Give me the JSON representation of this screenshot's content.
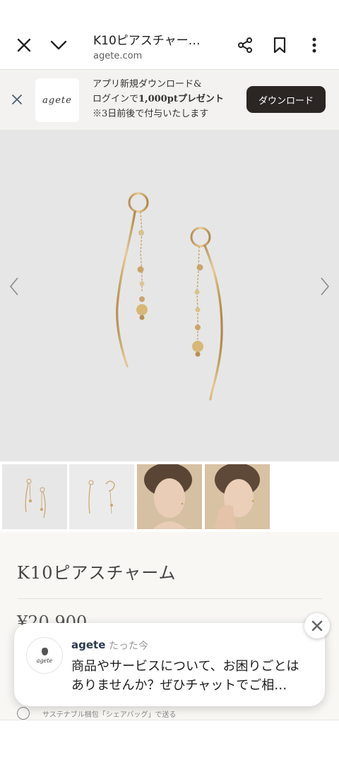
{
  "toolbar": {
    "title": "K10ピアスチャー…",
    "url": "agete.com",
    "icons": [
      "close-icon",
      "chevron-down-icon",
      "share-icon",
      "bookmark-icon",
      "more-vert-icon"
    ]
  },
  "banner": {
    "logo_text": "agete",
    "line1": "アプリ新規ダウンロード&",
    "line2_prefix": "ログインで",
    "line2_bold": "1,000ptプレゼント",
    "line3": "※3日前後で付与いたします",
    "download_label": "ダウンロード"
  },
  "product": {
    "name": "K10ピアスチャーム",
    "price": "¥20,900",
    "thumbnail_count": 4
  },
  "sustainable": {
    "label": "サステナブル梱包「シェアバッグ」で送る"
  },
  "chat": {
    "name": "agete",
    "time": "たった今",
    "message": "商品やサービスについて、お困りごとはありませんか？ぜひチャットでご相…",
    "avatar_text": "agete"
  },
  "colors": {
    "download_button": "#2b2523",
    "banner_bg": "#f3f2f0",
    "hero_bg": "#e6e6e6",
    "gold": "#c9a46a"
  }
}
